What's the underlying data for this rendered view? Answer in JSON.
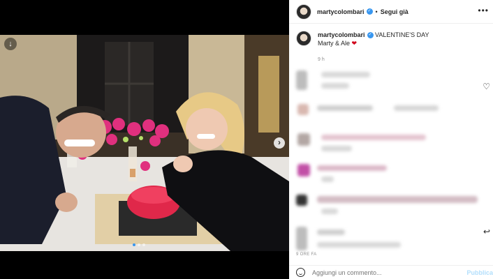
{
  "post": {
    "username": "martycolombari",
    "follow_status": "Segui già",
    "separator": "•",
    "more": "•••"
  },
  "caption": {
    "username": "martycolombari",
    "title": "VALENTINE'S DAY",
    "text": "Marty & Ale",
    "heart": "❤",
    "time": "9 h"
  },
  "media": {
    "prev_icon": "↓",
    "next_icon": "›"
  },
  "footer": {
    "post_time": "9 ORE FA",
    "comment_placeholder": "Aggiungi un commento...",
    "publish_label": "Pubblica"
  },
  "colors": {
    "verified": "#3897f0",
    "publish": "#b2dffc",
    "heart": "#d0021b"
  }
}
